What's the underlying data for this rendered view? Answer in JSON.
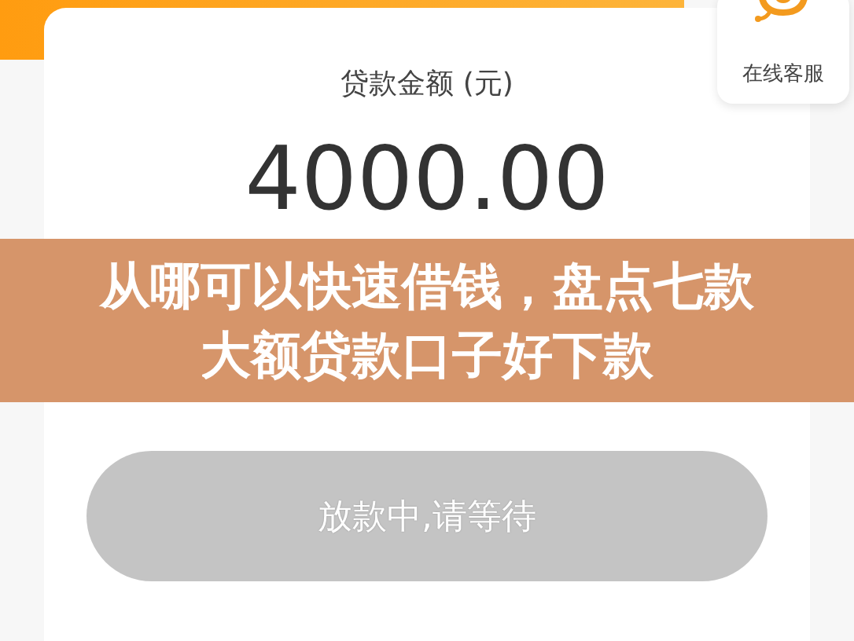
{
  "support": {
    "label": "在线客服"
  },
  "loan": {
    "label": "贷款金额 (元)",
    "amount": "4000.00"
  },
  "banner": {
    "lines": [
      "从哪可以快速借钱，盘点七款",
      "大额贷款口子好下款"
    ]
  },
  "action_button": {
    "label": "放款中,请等待",
    "disabled": true
  }
}
